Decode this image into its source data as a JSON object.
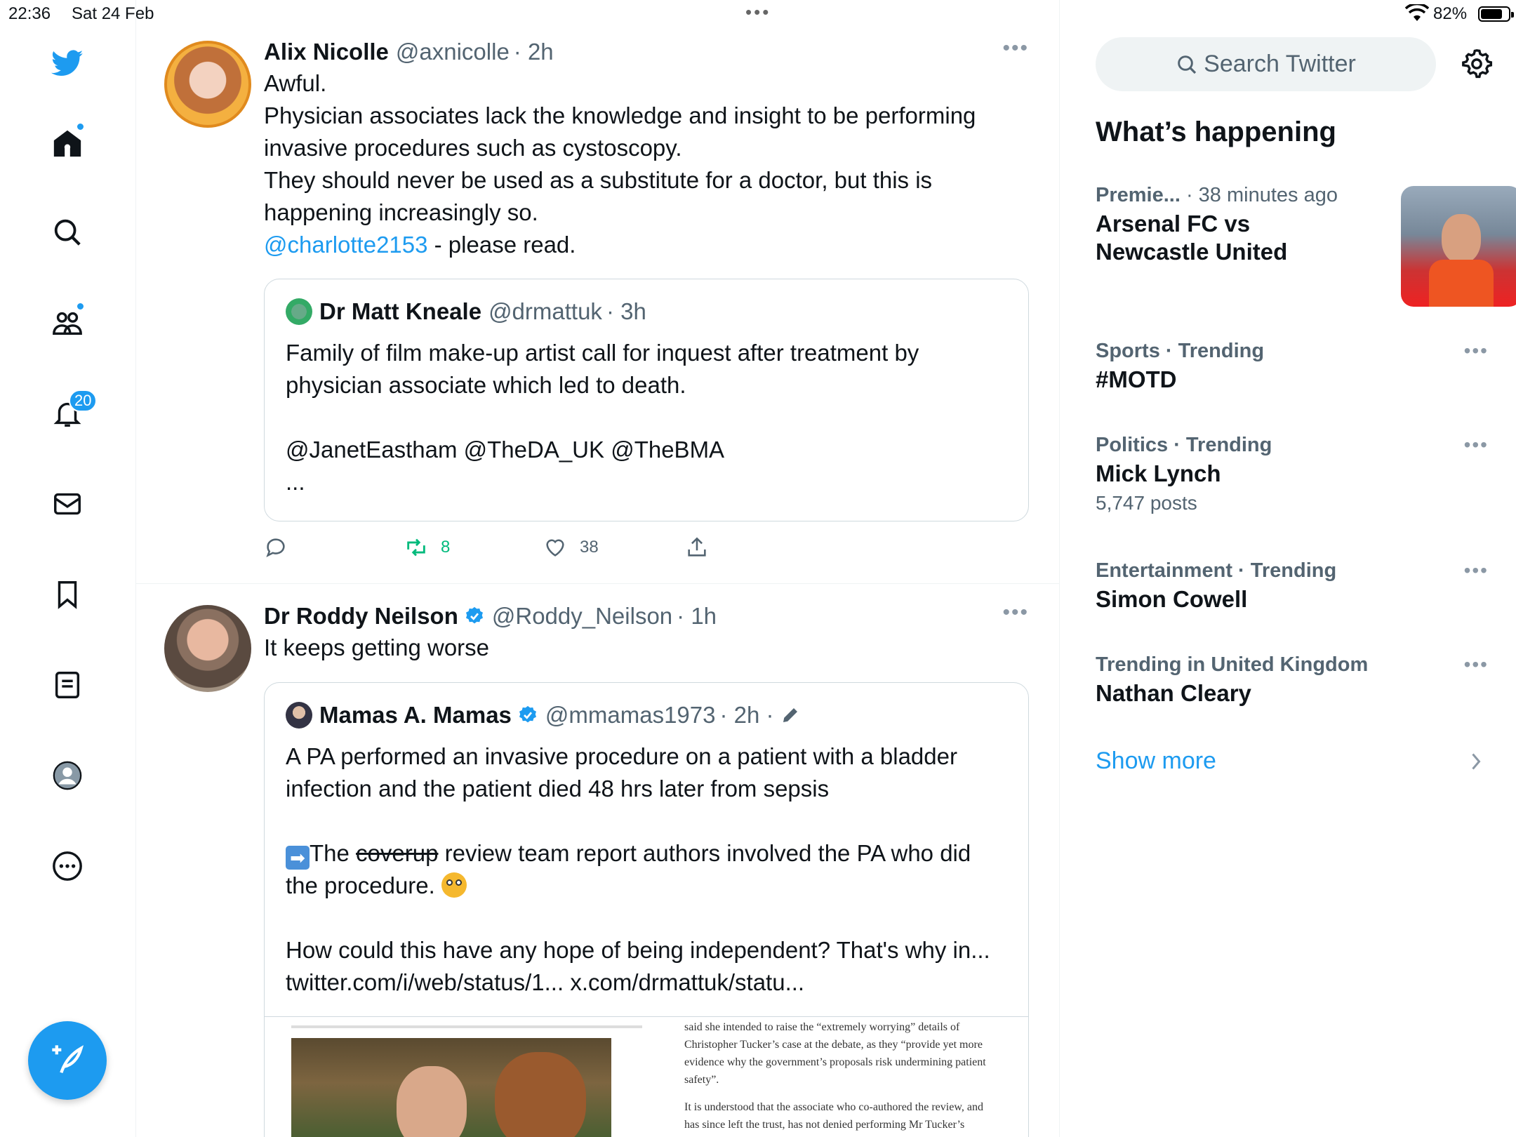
{
  "status": {
    "time": "22:36",
    "date": "Sat 24 Feb",
    "battery_percent": "82%",
    "battery_level": 0.82
  },
  "nav": {
    "icons": [
      "twitter-logo-icon",
      "home-icon",
      "search-icon",
      "communities-icon",
      "notifications-icon",
      "messages-icon",
      "bookmarks-icon",
      "lists-icon",
      "profile-icon",
      "more-icon"
    ],
    "notifications_count": "20"
  },
  "feed": {
    "tweets": [
      {
        "name": "Alix Nicolle",
        "handle": "@axnicolle",
        "time": "· 2h",
        "text_lines": [
          "Awful.",
          "Physician associates lack the knowledge and insight to be performing invasive procedures such as cystoscopy.",
          "They should never be used as a substitute for a doctor, but this is happening increasingly so."
        ],
        "mention": "@charlotte2153",
        "mention_suffix": " - please read.",
        "quote": {
          "name": "Dr Matt Kneale",
          "handle": "@drmattuk",
          "time": "· 3h",
          "text": "Family of film make-up artist call for inquest after treatment by physician associate which led to death.",
          "mentions": "@JanetEastham @TheDA_UK @TheBMA",
          "ellipsis": "..."
        },
        "actions": {
          "retweets": "8",
          "likes": "38"
        }
      },
      {
        "name": "Dr Roddy Neilson",
        "handle": "@Roddy_Neilson",
        "time": "· 1h",
        "text": "It keeps getting worse",
        "quote": {
          "name": "Mamas A. Mamas",
          "handle": "@mmamas1973",
          "time": "· 2h ·",
          "text1": "A PA performed an invasive procedure on a patient with a bladder infection and the patient died 48 hrs later from sepsis",
          "text2_prefix": "The ",
          "text2_strike": "coverup",
          "text2_suffix": " review team report authors involved the PA who did the procedure.",
          "text3": "How could this have any hope of being independent? That's why in... twitter.com/i/web/status/1... x.com/drmattuk/statu...",
          "article_p1": "said she intended to raise the “extremely worrying” details of Christopher Tucker’s case at the debate, as they “provide yet more evidence why the government’s proposals risk undermining patient safety”.",
          "article_p2": "It is understood that the associate who co-authored the review, and has since left the trust, has not denied performing Mr Tucker’s cystoscopy."
        }
      }
    ]
  },
  "sidebar": {
    "search_placeholder": "Search Twitter",
    "title": "What’s happening",
    "trends": [
      {
        "category": "Premie...",
        "meta": " · 38 minutes ago",
        "topic": "Arsenal FC vs Newcastle United"
      },
      {
        "category": "Sports · Trending",
        "topic": "#MOTD"
      },
      {
        "category": "Politics · Trending",
        "topic": "Mick Lynch",
        "posts": "5,747 posts"
      },
      {
        "category": "Entertainment · Trending",
        "topic": "Simon Cowell"
      },
      {
        "category": "Trending in United Kingdom",
        "topic": "Nathan Cleary"
      }
    ],
    "show_more": "Show more"
  },
  "colors": {
    "accent": "#1d9bf0",
    "retweet": "#00ba7c",
    "secondary_text": "#536471"
  }
}
